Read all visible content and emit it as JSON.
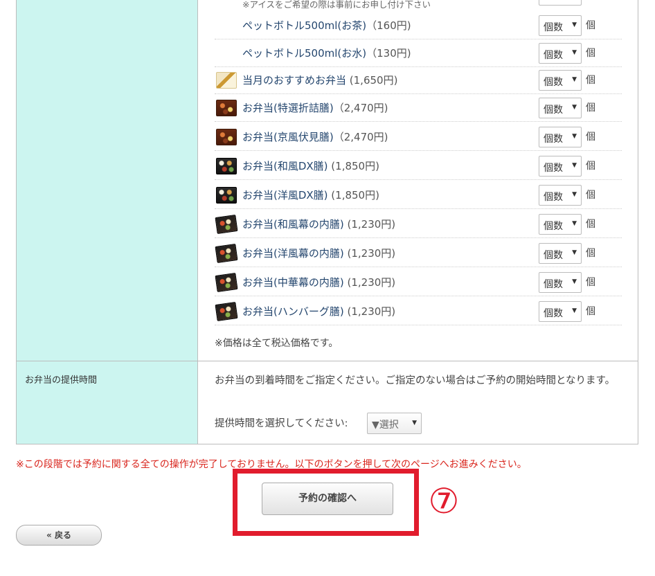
{
  "drinks": {
    "note_ice": "※アイスをご希望の際は事前にお申し付け下さい",
    "items": [
      {
        "name": "ペットボトル500ml(お茶)",
        "price": "（160円)"
      },
      {
        "name": "ペットボトル500ml(お水)",
        "price": "（130円)"
      }
    ]
  },
  "bento": {
    "items": [
      {
        "name": "当月のおすすめお弁当",
        "price": " (1,650円)",
        "icon": "bento-recommended-icon"
      },
      {
        "name": "お弁当(特選折詰膳)",
        "price": "（2,470円)",
        "icon": "bento-box-icon"
      },
      {
        "name": "お弁当(京風伏見膳)",
        "price": "（2,470円)",
        "icon": "bento-box-icon"
      },
      {
        "name": "お弁当(和風DX膳)",
        "price": " (1,850円)",
        "icon": "bento-box-icon"
      },
      {
        "name": "お弁当(洋風DX膳)",
        "price": " (1,850円)",
        "icon": "bento-box-icon"
      },
      {
        "name": "お弁当(和風幕の内膳)",
        "price": " (1,230円)",
        "icon": "bento-box-icon"
      },
      {
        "name": "お弁当(洋風幕の内膳)",
        "price": " (1,230円)",
        "icon": "bento-box-icon"
      },
      {
        "name": "お弁当(中華幕の内膳)",
        "price": " (1,230円)",
        "icon": "bento-box-icon"
      },
      {
        "name": "お弁当(ハンバーグ膳)",
        "price": " (1,230円)",
        "icon": "bento-box-icon"
      }
    ],
    "quantity_placeholder": "個数",
    "unit": "個",
    "tax_note": "※価格は全て税込価格です。"
  },
  "delivery": {
    "label": "お弁当の提供時間",
    "description": "お弁当の到着時間をご指定ください。ご指定のない場合はご予約の開始時間となります。",
    "select_label": "提供時間を選択してください:",
    "select_value": "▼選択"
  },
  "warning": "※この段階では予約に関する全ての操作が完了しておりません。以下のボタンを押して次のページへお進みください。",
  "buttons": {
    "confirm": "予約の確認へ",
    "back": "« 戻る"
  },
  "annotation": {
    "step_number": "⑦",
    "color": "#e11c2d"
  }
}
